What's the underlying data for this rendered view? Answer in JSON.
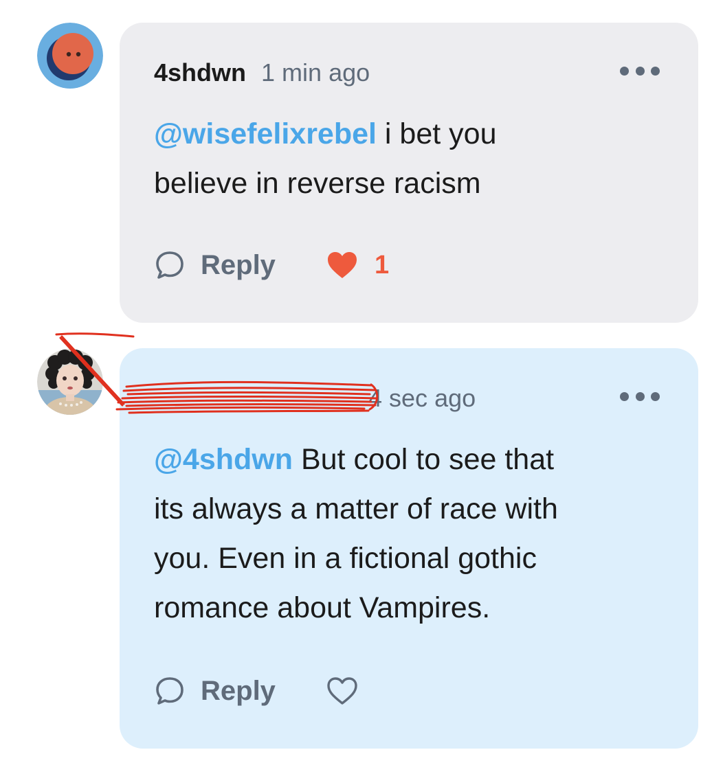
{
  "comments": [
    {
      "username": "4shdwn",
      "timestamp": "1 min ago",
      "mention": "@wisefelixrebel",
      "text_line1": " i bet you",
      "text_line2": "believe in reverse racism",
      "reply_label": "Reply",
      "like_count": "1",
      "liked": true,
      "more_icon": "more-horizontal-icon",
      "reply_icon": "speech-bubble-icon",
      "like_icon": "heart-filled-icon"
    },
    {
      "username": "",
      "username_redacted": true,
      "timestamp": "4 sec ago",
      "mention": "@4shdwn",
      "text_line1": " But cool to see that",
      "text_line2": "its always a matter of race with",
      "text_line3": "you. Even in a fictional gothic",
      "text_line4": "romance about Vampires.",
      "reply_label": "Reply",
      "liked": false,
      "more_icon": "more-horizontal-icon",
      "reply_icon": "speech-bubble-icon",
      "like_icon": "heart-outline-icon"
    }
  ],
  "colors": {
    "mention": "#4aa6e8",
    "like": "#ee5a3d",
    "secondary_text": "#5f6b7a",
    "bubble_gray": "#ededf0",
    "bubble_blue": "#ddeffc",
    "redaction_scribble": "#e0301e"
  }
}
